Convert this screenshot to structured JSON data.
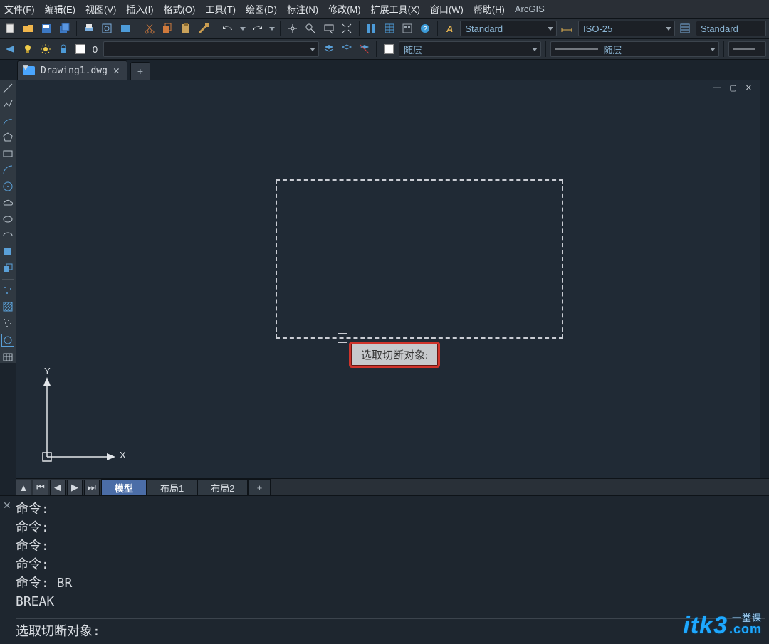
{
  "menu": {
    "items": [
      "文件(F)",
      "编辑(E)",
      "视图(V)",
      "插入(I)",
      "格式(O)",
      "工具(T)",
      "绘图(D)",
      "标注(N)",
      "修改(M)",
      "扩展工具(X)",
      "窗口(W)",
      "帮助(H)",
      "ArcGIS"
    ]
  },
  "toolbar": {
    "icons_row1": [
      "new-icon",
      "open-icon",
      "save-icon",
      "saveall-icon",
      "print-icon",
      "preview-icon",
      "plot-icon",
      "cut-icon",
      "copy-icon",
      "paste-icon",
      "match-icon",
      "undo-icon",
      "undo-drop-icon",
      "redo-icon",
      "redo-drop-icon",
      "pan-icon",
      "zoom-icon",
      "zoomwin-icon",
      "zoomext-icon",
      "sheet-icon",
      "props-icon",
      "tool-icon",
      "help-icon"
    ],
    "styles": {
      "text_style_label": "Standard",
      "dim_style_label": "ISO-25",
      "table_style_label": "Standard"
    }
  },
  "toolbar2": {
    "color_index": "0",
    "layer_label": "随层",
    "linetype_label": "随层"
  },
  "document": {
    "title": "Drawing1.dwg"
  },
  "sidebar": {
    "tools": [
      "line-icon",
      "pline-icon",
      "arc-icon",
      "pentagon-icon",
      "rect-icon",
      "curve-icon",
      "circle-icon",
      "cloud-icon",
      "ellipse-icon",
      "ellipse-arc-icon",
      "block-icon",
      "block2-icon",
      "point-icon",
      "hatch-icon",
      "noise-icon",
      "region-icon",
      "insert-icon",
      "table-icon"
    ]
  },
  "tooltip": {
    "text": "选取切断对象:"
  },
  "ucs": {
    "x": "X",
    "y": "Y"
  },
  "layout": {
    "tabs": [
      "模型",
      "布局1",
      "布局2"
    ],
    "active": 0
  },
  "command": {
    "history": [
      "命令:",
      "命令:",
      "命令:",
      "命令:",
      "命令: BR",
      "BREAK"
    ],
    "prompt": "选取切断对象:"
  },
  "watermark": {
    "name": "itk3",
    "domain": ".com",
    "sub": "一堂课"
  }
}
